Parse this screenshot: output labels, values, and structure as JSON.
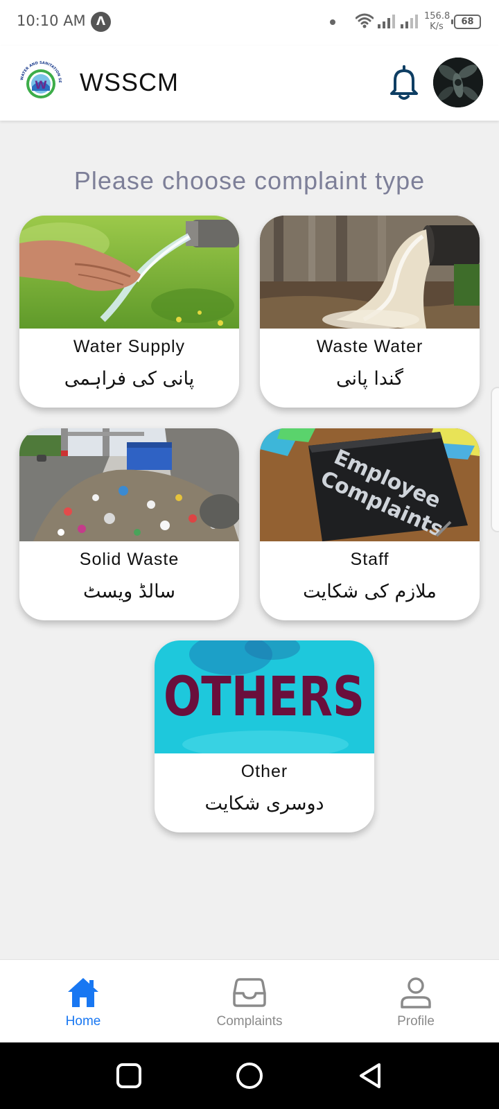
{
  "status_bar": {
    "time": "10:10 AM",
    "app_icon_glyph": "Λ",
    "net_speed_value": "156.8",
    "net_speed_unit": "K/s",
    "battery": "68"
  },
  "header": {
    "title": "WSSCM",
    "logo_letter": "W",
    "logo_ring_text": "WATER AND SANITATION SERVICES COMPANY MARDAN",
    "notification_icon": "bell-icon",
    "avatar_icon": "avatar"
  },
  "main": {
    "heading": "Please choose complaint type",
    "cards": [
      {
        "title_en": "Water Supply",
        "title_ur": "پانی کی فراہمی"
      },
      {
        "title_en": "Waste Water",
        "title_ur": "گندا پانی"
      },
      {
        "title_en": "Solid Waste",
        "title_ur": "سالڈ ویسٹ"
      },
      {
        "title_en": "Staff",
        "title_ur": "ملازم کی شکایت",
        "image_text_1": "Employee",
        "image_text_2": "Complaints"
      },
      {
        "title_en": "Other",
        "title_ur": "دوسری شکایت",
        "image_text": "OTHERS"
      }
    ]
  },
  "bottom_nav": {
    "items": [
      {
        "label": "Home",
        "icon": "home-icon",
        "active": true
      },
      {
        "label": "Complaints",
        "icon": "inbox-icon",
        "active": false
      },
      {
        "label": "Profile",
        "icon": "user-icon",
        "active": false
      }
    ]
  },
  "colors": {
    "accent": "#1877f2",
    "heading": "#7d7f98",
    "inactive_nav": "#8a8a8a",
    "background": "#f0f0f0"
  }
}
